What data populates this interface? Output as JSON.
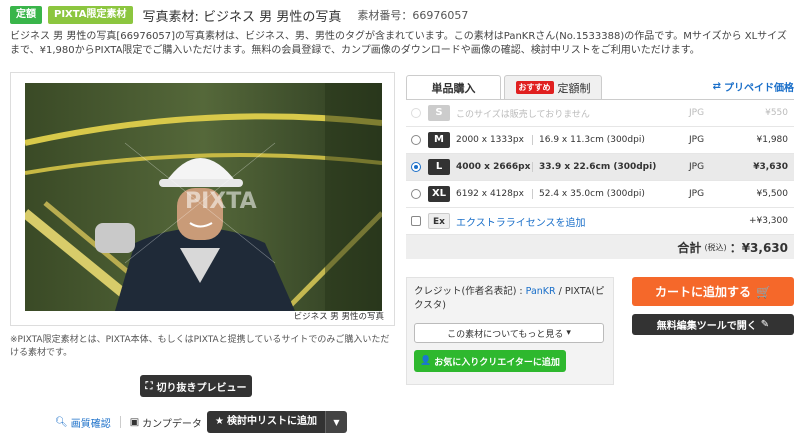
{
  "header": {
    "badge_plan": "定額",
    "badge_limited": "PIXTA限定素材",
    "title": "写真素材: ビジネス 男 男性の写真",
    "material_no": "素材番号：66976057"
  },
  "description": "ビジネス 男 男性の写真[66976057]の写真素材は、ビジネス、男、男性のタグが含まれています。この素材はPanKRさん(No.1533388)の作品です。Mサイズから XLサイズまで、¥1,980からPIXTA限定でご購入いただけます。無料の会員登録で、カンプ画像のダウンロードや画像の確認、検討中リストをご利用いただけます。",
  "photo": {
    "caption": "ビジネス 男 男性の写真",
    "watermark": "PIXTA"
  },
  "note": "※PIXTA限定素材とは、PIXTA本体、もしくはPIXTAと提携しているサイトでのみご購入いただける素材です。",
  "actions": {
    "crop_preview": "切り抜きプレビュー",
    "image_check": "画質確認",
    "comp_data": "カンプデータ",
    "add_to_list": "検討中リストに追加"
  },
  "purchase": {
    "tab_single": "単品購入",
    "tab_plan_tag": "おすすめ",
    "tab_plan": "定額制",
    "prepaid_link": "プリペイド価格",
    "sizes": [
      {
        "code": "S",
        "unavailable": "このサイズは販売しておりません",
        "format": "JPG",
        "price": "¥550"
      },
      {
        "code": "M",
        "px": "2000 x 1333px",
        "cm": "16.9 x 11.3cm (300dpi)",
        "format": "JPG",
        "price": "¥1,980"
      },
      {
        "code": "L",
        "px": "4000 x 2666px",
        "cm": "33.9 x 22.6cm (300dpi)",
        "format": "JPG",
        "price": "¥3,630"
      },
      {
        "code": "XL",
        "px": "6192 x 4128px",
        "cm": "52.4 x 35.0cm (300dpi)",
        "format": "JPG",
        "price": "¥5,500"
      }
    ],
    "extra": {
      "code": "Ex",
      "label": "エクストラライセンスを追加",
      "price": "+¥3,300"
    },
    "total_label": "合計",
    "total_tax": "(税込)",
    "total_value": "：¥3,630",
    "selected_size": "L"
  },
  "credit": {
    "prefix": "クレジット(作者名表記) : ",
    "author": "PanKR",
    "suffix": " / PIXTA(ピクスタ)",
    "more_button": "この素材についてもっと見る",
    "fav_button": "お気に入りクリエイターに追加"
  },
  "cart": {
    "add_button": "カートに追加する",
    "edit_button": "無料編集ツールで開く"
  },
  "colors": {
    "accent_blue": "#1a6fc9",
    "cart_orange": "#f5682a",
    "fav_green": "#2eb82e",
    "badge_green": "#39b54a"
  }
}
